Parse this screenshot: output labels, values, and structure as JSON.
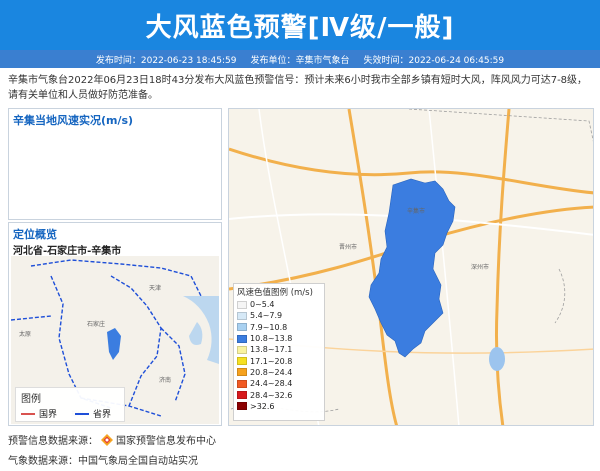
{
  "header": {
    "title": "大风蓝色预警[Ⅳ级/一般]"
  },
  "meta": {
    "publish_time": "发布时间：2022-06-23 18:45:59",
    "publisher": "发布单位：辛集市气象台",
    "expire_time": "失效时间：2022-06-24 06:45:59"
  },
  "description": "辛集市气象台2022年06月23日18时43分发布大风蓝色预警信号：预计未来6小时我市全部乡镇有短时大风，阵风风力可达7-8级，请有关单位和人员做好防范准备。",
  "wind_panel": {
    "title": "辛集当地风速实况(m/s)"
  },
  "location_panel": {
    "title": "定位概览",
    "subtitle": "河北省-石家庄市-辛集市",
    "map_labels": {
      "tianjin": "天津",
      "shijiazhuang": "石家庄",
      "taiyuan": "太原",
      "jinan": "济南",
      "zhengzhou": "郑州"
    },
    "legend": {
      "title": "图例",
      "national_border": "国界",
      "provincial_border": "省界",
      "national_color": "#d9534f",
      "provincial_color": "#1e4fd8"
    }
  },
  "main_map": {
    "labels": {
      "xinji": "辛集市",
      "shenzhou": "深州市",
      "jinzhou": "晋州市"
    },
    "region_color": "#3b7de0",
    "legend": {
      "title": "风速色值图例 (m/s)",
      "items": [
        {
          "label": "0~5.4",
          "color": "#f5f5f5"
        },
        {
          "label": "5.4~7.9",
          "color": "#d6e9f7"
        },
        {
          "label": "7.9~10.8",
          "color": "#a9d1f1"
        },
        {
          "label": "10.8~13.8",
          "color": "#3b7de0"
        },
        {
          "label": "13.8~17.1",
          "color": "#f9f3a0"
        },
        {
          "label": "17.1~20.8",
          "color": "#f6e022"
        },
        {
          "label": "20.8~24.4",
          "color": "#f6a21e"
        },
        {
          "label": "24.4~28.4",
          "color": "#f15a22"
        },
        {
          "label": "28.4~32.6",
          "color": "#d7191c"
        },
        {
          "label": ">32.6",
          "color": "#8b0000"
        }
      ]
    }
  },
  "footer": {
    "warning_source": "预警信息数据来源：",
    "warning_source_name": "国家预警信息发布中心",
    "weather_source": "气象数据来源：中国气象局全国自动站实况"
  }
}
